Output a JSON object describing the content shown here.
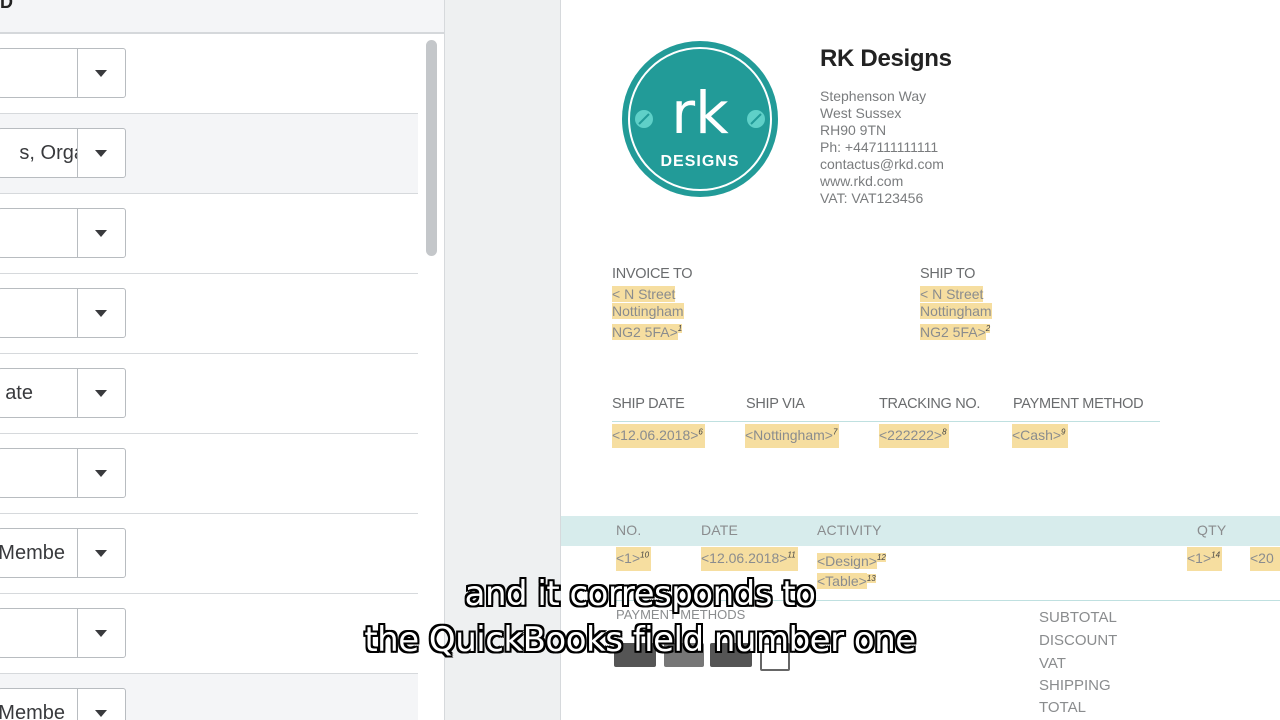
{
  "left_panel": {
    "header_title": "D",
    "fields": [
      {
        "value": ""
      },
      {
        "value": "s, Orga"
      },
      {
        "value": ""
      },
      {
        "value": ""
      },
      {
        "value": "ate"
      },
      {
        "value": ""
      },
      {
        "value": "Membe"
      },
      {
        "value": ""
      },
      {
        "value": "Membe"
      }
    ]
  },
  "invoice": {
    "logo": {
      "initials": "rk",
      "word": "DESIGNS",
      "color": "#229b98"
    },
    "company_name": "RK Designs",
    "address_lines": [
      "Stephenson Way",
      "West Sussex",
      "RH90 9TN",
      "Ph:  +447111111111",
      "contactus@rkd.com",
      "www.rkd.com",
      "VAT: VAT123456"
    ],
    "invoice_to": {
      "label": "INVOICE TO",
      "lines": [
        "< N Street",
        "Nottingham",
        "NG2 5FA>"
      ],
      "field_no": "1"
    },
    "ship_to": {
      "label": "SHIP TO",
      "lines": [
        "< N Street",
        "Nottingham",
        "NG2 5FA>"
      ],
      "field_no": "2"
    },
    "ship_fields": [
      {
        "label": "SHIP DATE",
        "value": "<12.06.2018>",
        "field_no": "6"
      },
      {
        "label": "SHIP VIA",
        "value": "<Nottingham>",
        "field_no": "7"
      },
      {
        "label": "TRACKING NO.",
        "value": "<222222>",
        "field_no": "8"
      },
      {
        "label": "PAYMENT METHOD",
        "value": "<Cash>",
        "field_no": "9"
      }
    ],
    "table": {
      "headers": [
        "NO.",
        "DATE",
        "ACTIVITY",
        "QTY"
      ],
      "row": {
        "no": "<1>",
        "no_field": "10",
        "date": "<12.06.2018>",
        "date_field": "11",
        "activity": "<Design>",
        "activity_field": "12",
        "activity2": "<Table>",
        "activity2_field": "13",
        "qty": "<1>",
        "qty_field": "14",
        "rate": "<20"
      }
    },
    "payment_methods_label": "PAYMENT METHODS",
    "totals": [
      "SUBTOTAL",
      "DISCOUNT",
      "VAT",
      "SHIPPING",
      "TOTAL"
    ]
  },
  "caption": {
    "line1": "and it corresponds to",
    "line2": "the QuickBooks field number one"
  }
}
